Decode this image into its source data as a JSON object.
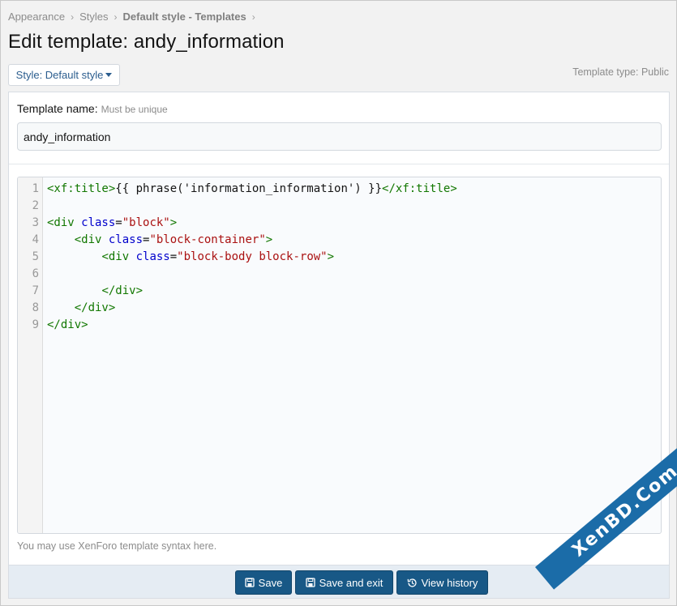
{
  "breadcrumb": [
    {
      "label": "Appearance"
    },
    {
      "label": "Styles"
    },
    {
      "label": "Default style - Templates"
    }
  ],
  "page_title": "Edit template: andy_information",
  "style_selector": {
    "label": "Style: Default style"
  },
  "template_type": "Template type: Public",
  "form": {
    "name_label": "Template name:",
    "name_hint": "Must be unique",
    "name_value": "andy_information",
    "editor_hint": "You may use XenForo template syntax here."
  },
  "code_lines": [
    {
      "num": "1",
      "text": "<xf:title>{{ phrase('information_information') }}</xf:title>"
    },
    {
      "num": "2",
      "text": ""
    },
    {
      "num": "3",
      "text": "<div class=\"block\">"
    },
    {
      "num": "4",
      "text": "    <div class=\"block-container\">"
    },
    {
      "num": "5",
      "text": "        <div class=\"block-body block-row\">"
    },
    {
      "num": "6",
      "text": ""
    },
    {
      "num": "7",
      "text": "        </div>"
    },
    {
      "num": "8",
      "text": "    </div>"
    },
    {
      "num": "9",
      "text": "</div>"
    }
  ],
  "buttons": {
    "save": "Save",
    "save_exit": "Save and exit",
    "view_history": "View history"
  },
  "watermark": "XenBD.Com",
  "colors": {
    "accent": "#185886",
    "link": "#2b5d8e",
    "tag": "#117700",
    "attr": "#0000cc",
    "string": "#aa1111"
  }
}
